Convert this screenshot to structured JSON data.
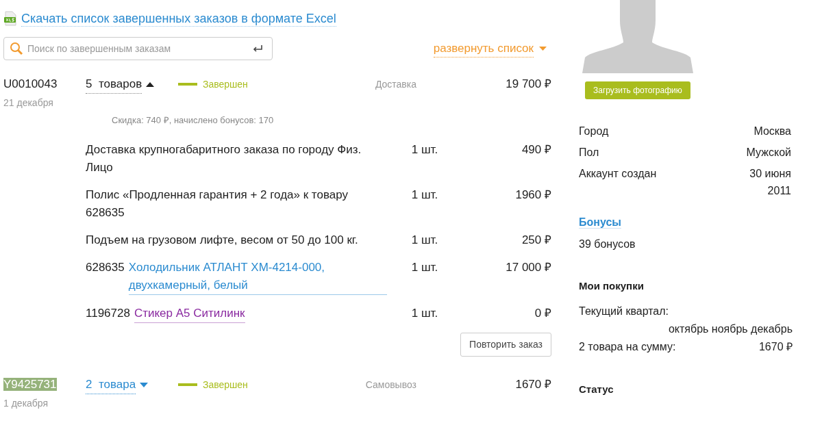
{
  "export_link": {
    "label": "Скачать список завершенных заказов в формате Excel"
  },
  "search": {
    "placeholder": "Поиск по завершенным заказам"
  },
  "expand_all": {
    "label": "развернуть список"
  },
  "orders": [
    {
      "id": "U0010043",
      "selected": false,
      "date": "21 декабря",
      "count": "5  товаров",
      "expanded": true,
      "status": "Завершен",
      "delivery": "Доставка",
      "total": "19 700 ₽",
      "summary": "Скидка: 740 ₽, начислено бонусов: 170",
      "items": [
        {
          "kind": "text",
          "name": "Доставка крупногабаритного заказа по городу Физ. Лицо",
          "qty": "1 шт.",
          "price": "490 ₽"
        },
        {
          "kind": "text",
          "name": "Полис «Продленная гарантия + 2 года» к товару 628635",
          "qty": "1 шт.",
          "price": "1960 ₽"
        },
        {
          "kind": "text",
          "name": "Подъем на грузовом лифте, весом от 50 до 100 кг.",
          "qty": "1 шт.",
          "price": "250 ₽"
        },
        {
          "kind": "link",
          "code": "628635",
          "name": "Холодильник АТЛАНТ ХМ-4214-000, двухкамерный, белый",
          "qty": "1 шт.",
          "price": "17 000 ₽"
        },
        {
          "kind": "visited",
          "code": "1196728",
          "name": "Стикер А5 Ситилинк",
          "qty": "1 шт.",
          "price": "0 ₽"
        }
      ],
      "repeat_button": "Повторить заказ"
    },
    {
      "id": "Y9425731",
      "selected": true,
      "date": "1 декабря",
      "count": "2  товара",
      "expanded": false,
      "status": "Завершен",
      "delivery": "Самовывоз",
      "total": "1670 ₽"
    }
  ],
  "profile": {
    "upload_button": "Загрузить фотографию",
    "fields": [
      {
        "label": "Город",
        "value": "Москва"
      },
      {
        "label": "Пол",
        "value": "Мужской"
      },
      {
        "label": "Аккаунт создан",
        "value": "30 июня 2011"
      }
    ],
    "bonuses": {
      "title": "Бонусы",
      "value": "39 бонусов"
    },
    "purchases": {
      "title": "Мои покупки",
      "period_label": "Текущий квартал:",
      "months": "октябрь ноябрь декабрь",
      "sum_label": "2 товара на сумму:",
      "sum": "1670 ₽"
    },
    "status_title": "Статус"
  }
}
